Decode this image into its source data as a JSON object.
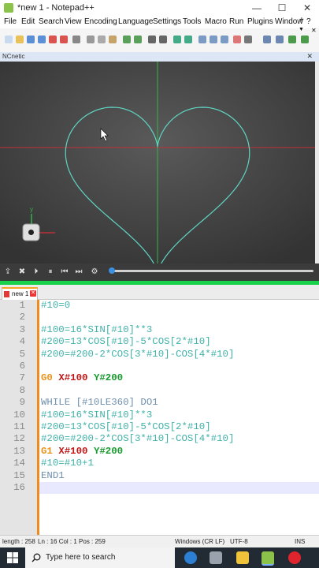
{
  "window": {
    "title": "*new 1 - Notepad++",
    "minimize": "—",
    "maximize": "☐",
    "close": "✕"
  },
  "menu": [
    "File",
    "Edit",
    "Search",
    "View",
    "Encoding",
    "Language",
    "Settings",
    "Tools",
    "Macro",
    "Run",
    "Plugins",
    "Window",
    "?"
  ],
  "menu_extra": {
    "plus": "+",
    "down": "▼",
    "close": "✕"
  },
  "panel": {
    "title": "NCnetic",
    "close": "✕"
  },
  "viewport": {
    "axis_y_label": "y",
    "background": "#4a4a4a",
    "curve_color": "#5fd6c4"
  },
  "sim_controls": [
    "export-icon",
    "stop-icon",
    "play-icon",
    "pause-icon",
    "step-back-icon",
    "step-forward-icon",
    "settings-icon"
  ],
  "tab": {
    "name": "new 1"
  },
  "editor": {
    "lines": [
      {
        "n": "1",
        "parts": [
          {
            "t": "#10=0",
            "c": "teal"
          }
        ]
      },
      {
        "n": "2",
        "parts": []
      },
      {
        "n": "3",
        "parts": [
          {
            "t": "#100=16*SIN[#10]**3",
            "c": "teal"
          }
        ]
      },
      {
        "n": "4",
        "parts": [
          {
            "t": "#200=13*COS[#10]-5*COS[2*#10]",
            "c": "teal"
          }
        ]
      },
      {
        "n": "5",
        "parts": [
          {
            "t": "#200=#200-2*COS[3*#10]-COS[4*#10]",
            "c": "teal"
          }
        ]
      },
      {
        "n": "6",
        "parts": []
      },
      {
        "n": "7",
        "parts": [
          {
            "t": "G0 ",
            "c": "orange"
          },
          {
            "t": "X#100 ",
            "c": "red"
          },
          {
            "t": "Y#200",
            "c": "green"
          }
        ]
      },
      {
        "n": "8",
        "parts": []
      },
      {
        "n": "9",
        "parts": [
          {
            "t": "WHILE [#10LE360] DO1",
            "c": "blue"
          }
        ]
      },
      {
        "n": "10",
        "parts": [
          {
            "t": "#100=16*SIN[#10]**3",
            "c": "teal"
          }
        ]
      },
      {
        "n": "11",
        "parts": [
          {
            "t": "#200=13*COS[#10]-5*COS[2*#10]",
            "c": "teal"
          }
        ]
      },
      {
        "n": "12",
        "parts": [
          {
            "t": "#200=#200-2*COS[3*#10]-COS[4*#10]",
            "c": "teal"
          }
        ]
      },
      {
        "n": "13",
        "parts": [
          {
            "t": "G1 ",
            "c": "orange"
          },
          {
            "t": "X#100 ",
            "c": "red"
          },
          {
            "t": "Y#200",
            "c": "green"
          }
        ]
      },
      {
        "n": "14",
        "parts": [
          {
            "t": "#10=#10+1",
            "c": "teal"
          }
        ]
      },
      {
        "n": "15",
        "parts": [
          {
            "t": "END1",
            "c": "blue"
          }
        ]
      },
      {
        "n": "16",
        "parts": []
      }
    ]
  },
  "status": {
    "length": "length : 258",
    "position": "Ln : 16    Col : 1    Pos : 259",
    "eol": "Windows (CR LF)",
    "encoding": "UTF-8",
    "mode": "INS"
  },
  "taskbar": {
    "search_placeholder": "Type here to search"
  }
}
